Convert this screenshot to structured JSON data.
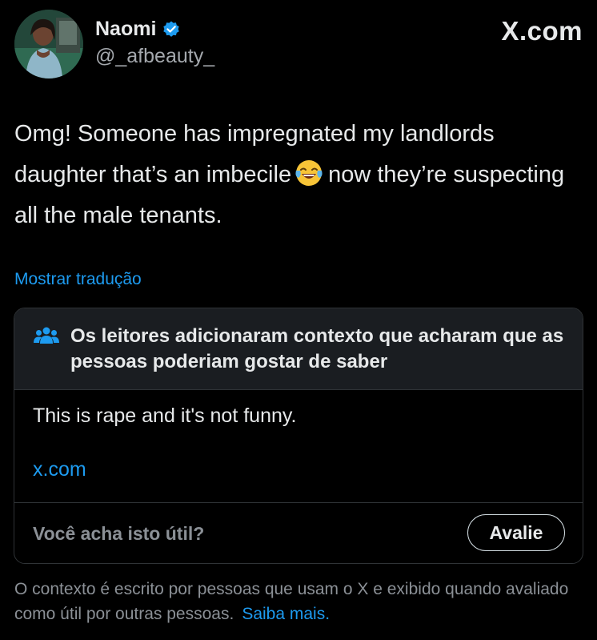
{
  "author": {
    "name": "Naomi",
    "handle": "@_afbeauty_",
    "verified": true,
    "avatar_icon": "profile-photo"
  },
  "site": {
    "label": "X.com"
  },
  "tweet": {
    "text_before_emoji": "Omg! Someone has impregnated my landlords daughter that’s an imbecile",
    "emoji": "face-with-tears-of-joy-icon",
    "text_after_emoji": "now they’re suspecting all the male tenants."
  },
  "translate": {
    "label": "Mostrar tradução"
  },
  "community_note": {
    "icon": "people-icon",
    "title": "Os leitores adicionaram contexto que acharam que as pessoas poderiam gostar de saber",
    "body": "This is rape and it's not funny.",
    "link": "x.com",
    "question": "Você acha isto útil?",
    "rate_button": "Avalie"
  },
  "footer": {
    "text": "O contexto é escrito por pessoas que usam o X e exibido quando avaliado como útil por outras pessoas.",
    "link": "Saiba mais."
  },
  "colors": {
    "background": "#000000",
    "text": "#e7e9ea",
    "muted": "#8b9096",
    "accent": "#1d9bf0",
    "verified": "#1d9bf0",
    "card_header": "#1a1d21",
    "border": "#2f3336"
  }
}
